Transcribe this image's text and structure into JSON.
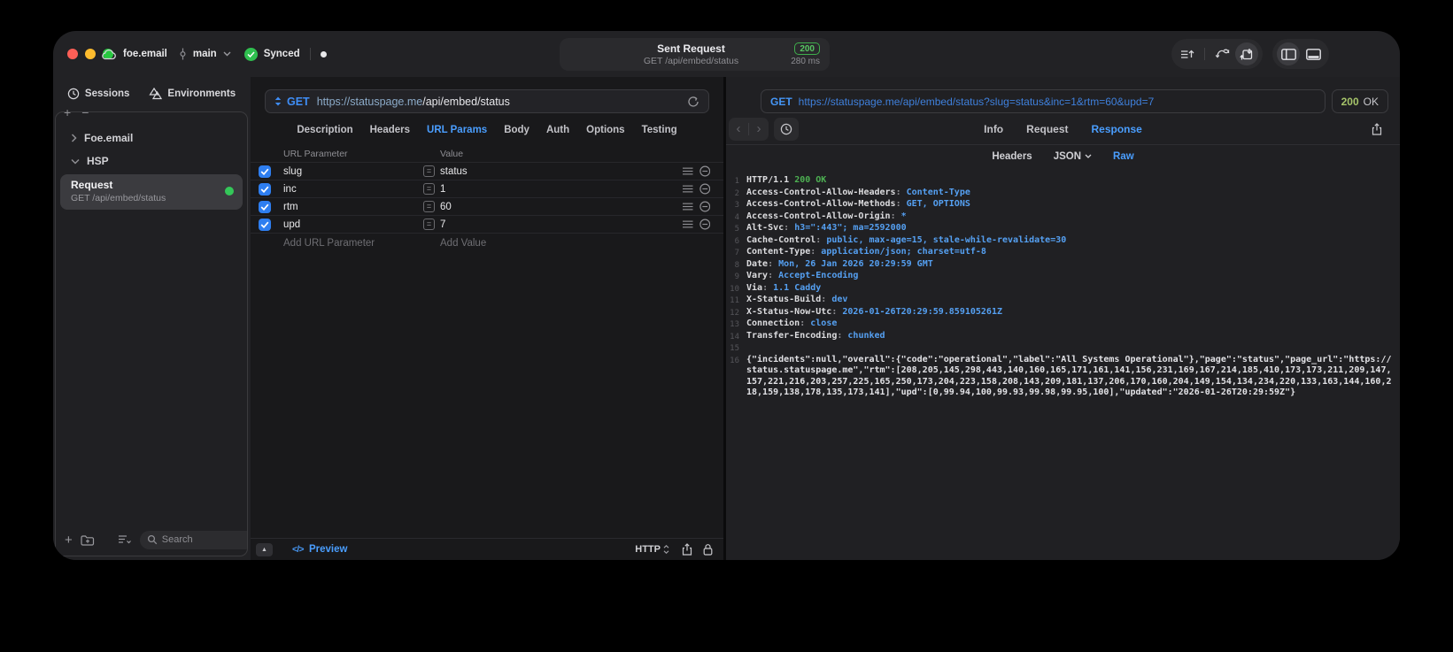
{
  "titlebar": {
    "project": "foe.email",
    "branch": "main",
    "sync": "Synced",
    "request_title": "Sent Request",
    "request_subtitle": "GET /api/embed/status",
    "status_code": "200",
    "duration": "280 ms"
  },
  "sidebar": {
    "tabs": [
      {
        "label": "Sessions"
      },
      {
        "label": "Environments"
      }
    ],
    "tree": [
      {
        "label": "Foe.email"
      },
      {
        "label": "HSP"
      }
    ],
    "request": {
      "title": "Request",
      "subtitle": "GET /api/embed/status"
    },
    "search_placeholder": "Search"
  },
  "request_editor": {
    "method": "GET",
    "url_host": "https://statuspage.me",
    "url_path": "/api/embed/status",
    "tabs": [
      "Description",
      "Headers",
      "URL Params",
      "Body",
      "Auth",
      "Options",
      "Testing"
    ],
    "active_tab": "URL Params",
    "params": {
      "col_param": "URL Parameter",
      "col_value": "Value",
      "rows": [
        {
          "name": "slug",
          "value": "status",
          "enabled": true
        },
        {
          "name": "inc",
          "value": "1",
          "enabled": true
        },
        {
          "name": "rtm",
          "value": "60",
          "enabled": true
        },
        {
          "name": "upd",
          "value": "7",
          "enabled": true
        }
      ],
      "add_param_placeholder": "Add URL Parameter",
      "add_value_placeholder": "Add Value"
    },
    "footer": {
      "preview_label": "Preview",
      "http_label": "HTTP"
    }
  },
  "response_viewer": {
    "method": "GET",
    "url": "https://statuspage.me/api/embed/status?slug=status&inc=1&rtm=60&upd=7",
    "status_code": "200",
    "status_text": "OK",
    "tabs": [
      "Info",
      "Request",
      "Response"
    ],
    "active_tab": "Response",
    "subtabs": [
      "Headers",
      "JSON",
      "Raw"
    ],
    "active_subtab": "Raw",
    "status_line": {
      "protocol": "HTTP/1.1",
      "status": "200 OK"
    },
    "headers": [
      {
        "name": "Access-Control-Allow-Headers",
        "value": "Content-Type"
      },
      {
        "name": "Access-Control-Allow-Methods",
        "value": "GET, OPTIONS"
      },
      {
        "name": "Access-Control-Allow-Origin",
        "value": "*"
      },
      {
        "name": "Alt-Svc",
        "value": "h3=\":443\"; ma=2592000"
      },
      {
        "name": "Cache-Control",
        "value": "public, max-age=15, stale-while-revalidate=30"
      },
      {
        "name": "Content-Type",
        "value": "application/json; charset=utf-8"
      },
      {
        "name": "Date",
        "value": "Mon, 26 Jan 2026 20:29:59 GMT"
      },
      {
        "name": "Vary",
        "value": "Accept-Encoding"
      },
      {
        "name": "Via",
        "value": "1.1 Caddy"
      },
      {
        "name": "X-Status-Build",
        "value": "dev"
      },
      {
        "name": "X-Status-Now-Utc",
        "value": "2026-01-26T20:29:59.859105261Z"
      },
      {
        "name": "Connection",
        "value": "close"
      },
      {
        "name": "Transfer-Encoding",
        "value": "chunked"
      }
    ],
    "body": "{\"incidents\":null,\"overall\":{\"code\":\"operational\",\"label\":\"All Systems Operational\"},\"page\":\"status\",\"page_url\":\"https://status.statuspage.me\",\"rtm\":[208,205,145,298,443,140,160,165,171,161,141,156,231,169,167,214,185,410,173,173,211,209,147,157,221,216,203,257,225,165,250,173,204,223,158,208,143,209,181,137,206,170,160,204,149,154,134,234,220,133,163,144,160,218,159,138,178,135,173,141],\"upd\":[0,99.94,100,99.93,99.98,99.95,100],\"updated\":\"2026-01-26T20:29:59Z\"}"
  },
  "colors": {
    "accent_blue": "#4a9eff",
    "value_blue": "#55a0f2",
    "success_green": "#34c759",
    "status_code_green": "#a6c46a",
    "header_green": "#4db052"
  }
}
